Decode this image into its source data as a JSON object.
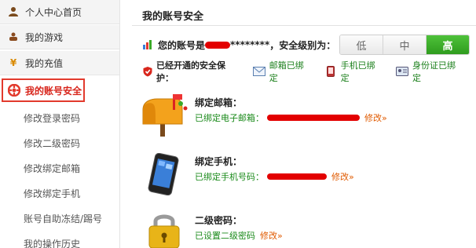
{
  "sidebar": {
    "top_items": [
      {
        "label": "个人中心首页",
        "icon": "user-icon"
      },
      {
        "label": "我的游戏",
        "icon": "game-icon"
      },
      {
        "label": "我的充值",
        "icon": "yen-icon"
      }
    ],
    "active_item": {
      "label": "我的账号安全",
      "icon": "lifebuoy-icon"
    },
    "sub_items": [
      "修改登录密码",
      "修改二级密码",
      "修改绑定邮箱",
      "修改绑定手机",
      "账号自助冻结/踢号",
      "我的操作历史"
    ]
  },
  "main": {
    "title": "我的账号安全",
    "account": {
      "prefix": "您的账号是",
      "masked": "********",
      "security_label": "，安全级别为：",
      "levels": [
        "低",
        "中",
        "高"
      ],
      "active_level": "高"
    },
    "protection": {
      "label": "已经开通的安全保护：",
      "items": [
        {
          "label": "邮箱已绑定",
          "icon": "mail-icon"
        },
        {
          "label": "手机已绑定",
          "icon": "phone-icon"
        },
        {
          "label": "身份证已绑定",
          "icon": "id-card-icon"
        }
      ]
    },
    "email": {
      "title": "绑定邮箱：",
      "status": "已绑定电子邮箱：",
      "modify": "修改»"
    },
    "phone": {
      "title": "绑定手机：",
      "status": "已绑定手机号码：",
      "modify": "修改»"
    },
    "password": {
      "title": "二级密码：",
      "status": "已设置二级密码",
      "modify": "修改»"
    }
  },
  "colors": {
    "accent_red": "#e23a2d",
    "green": "#1a8a1a",
    "link_orange": "#e05a00",
    "level_green": "#3aaa28"
  }
}
